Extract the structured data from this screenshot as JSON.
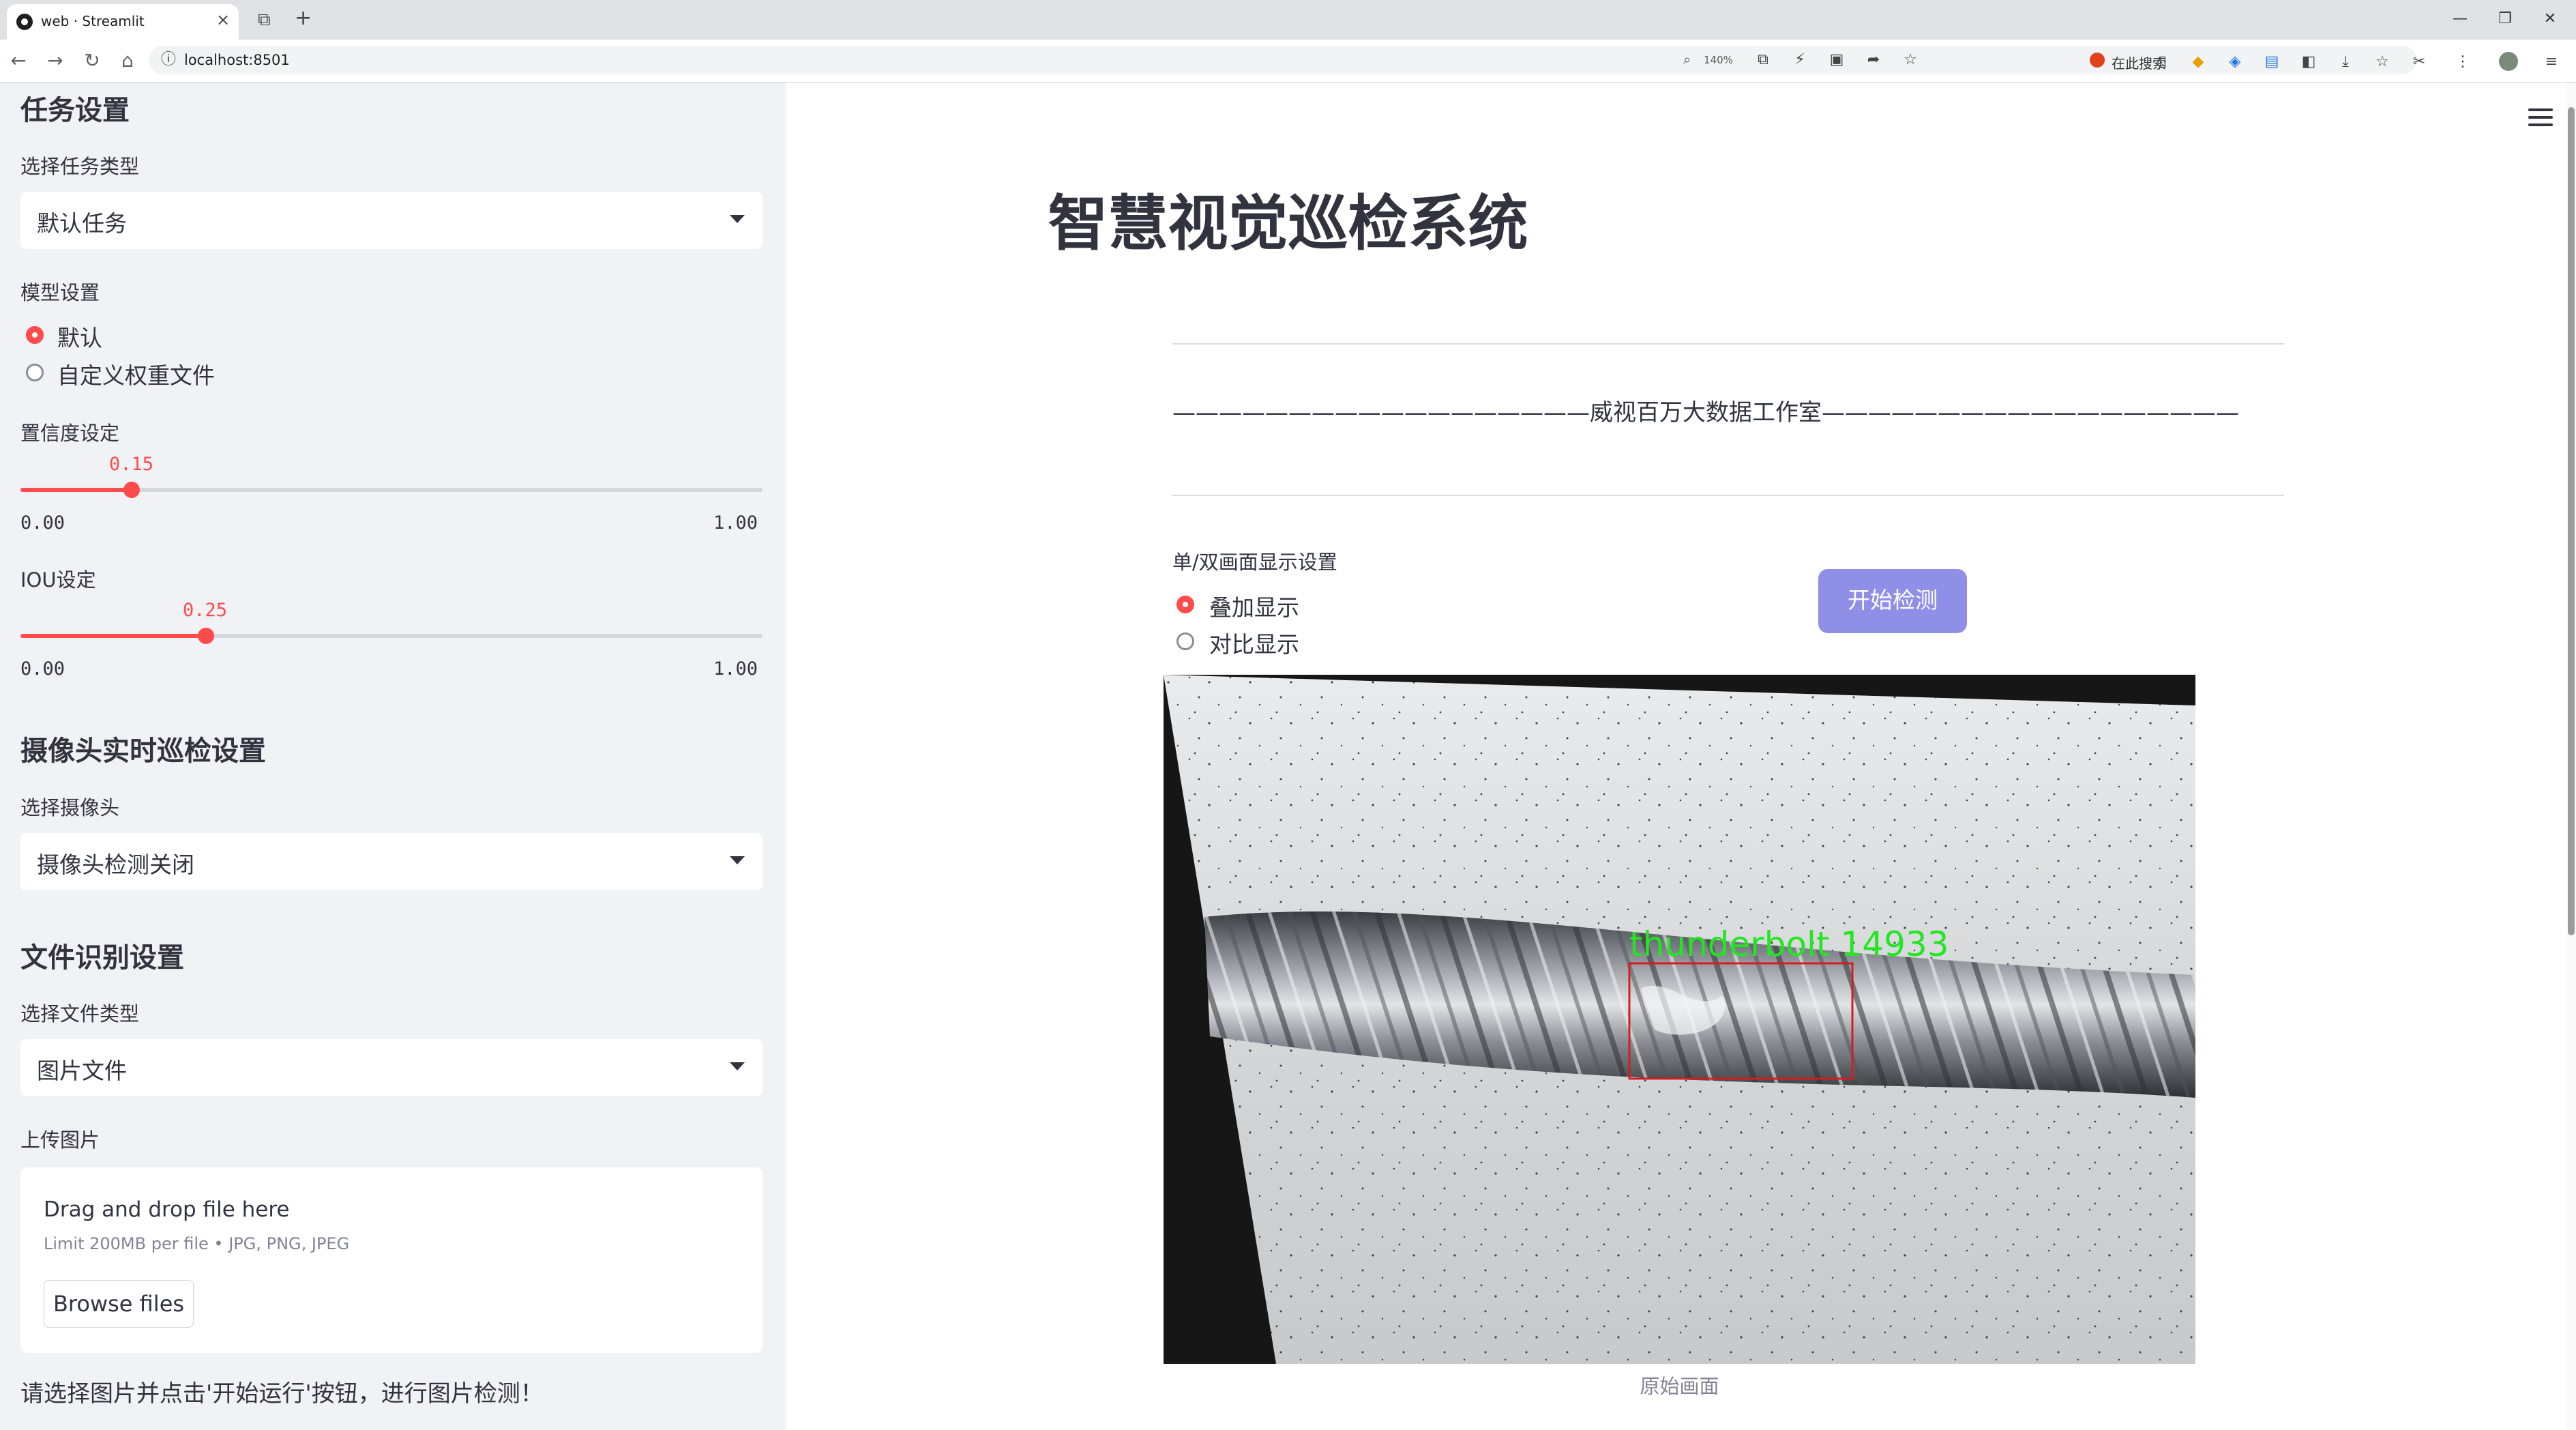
{
  "browser": {
    "tab_title": "web · Streamlit",
    "url": "localhost:8501",
    "zoom": "140%",
    "search_label": "在此搜索"
  },
  "sidebar": {
    "task_header": "任务设置",
    "task_type_label": "选择任务类型",
    "task_type_value": "默认任务",
    "model_label": "模型设置",
    "model_options": [
      "默认",
      "自定义权重文件"
    ],
    "model_selected": 0,
    "conf_label": "置信度设定",
    "conf": {
      "value": "0.15",
      "min": "0.00",
      "max": "1.00",
      "fraction": 0.15
    },
    "iou_label": "IOU设定",
    "iou": {
      "value": "0.25",
      "min": "0.00",
      "max": "1.00",
      "fraction": 0.25
    },
    "camera_header": "摄像头实时巡检设置",
    "camera_label": "选择摄像头",
    "camera_value": "摄像头检测关闭",
    "file_header": "文件识别设置",
    "file_type_label": "选择文件类型",
    "file_type_value": "图片文件",
    "upload_label": "上传图片",
    "upload_drop": "Drag and drop file here",
    "upload_limit": "Limit 200MB per file • JPG, PNG, JPEG",
    "browse_label": "Browse files",
    "hint": "请选择图片并点击'开始运行'按钮，进行图片检测！"
  },
  "main": {
    "title": "智慧视觉巡检系统",
    "subtitle": "——————————————————威视百万大数据工作室——————————————————",
    "display_label": "单/双画面显示设置",
    "display_options": [
      "叠加显示",
      "对比显示"
    ],
    "display_selected": 0,
    "start_button": "开始检测",
    "detection_label": "thunderbolt 14933",
    "image_caption": "原始画面"
  },
  "colors": {
    "accent": "#ff4b4b",
    "button": "#8f8fe8",
    "sidebar_bg": "#f0f2f6",
    "detect_box": "#d11f1f",
    "detect_text": "#22e622"
  }
}
